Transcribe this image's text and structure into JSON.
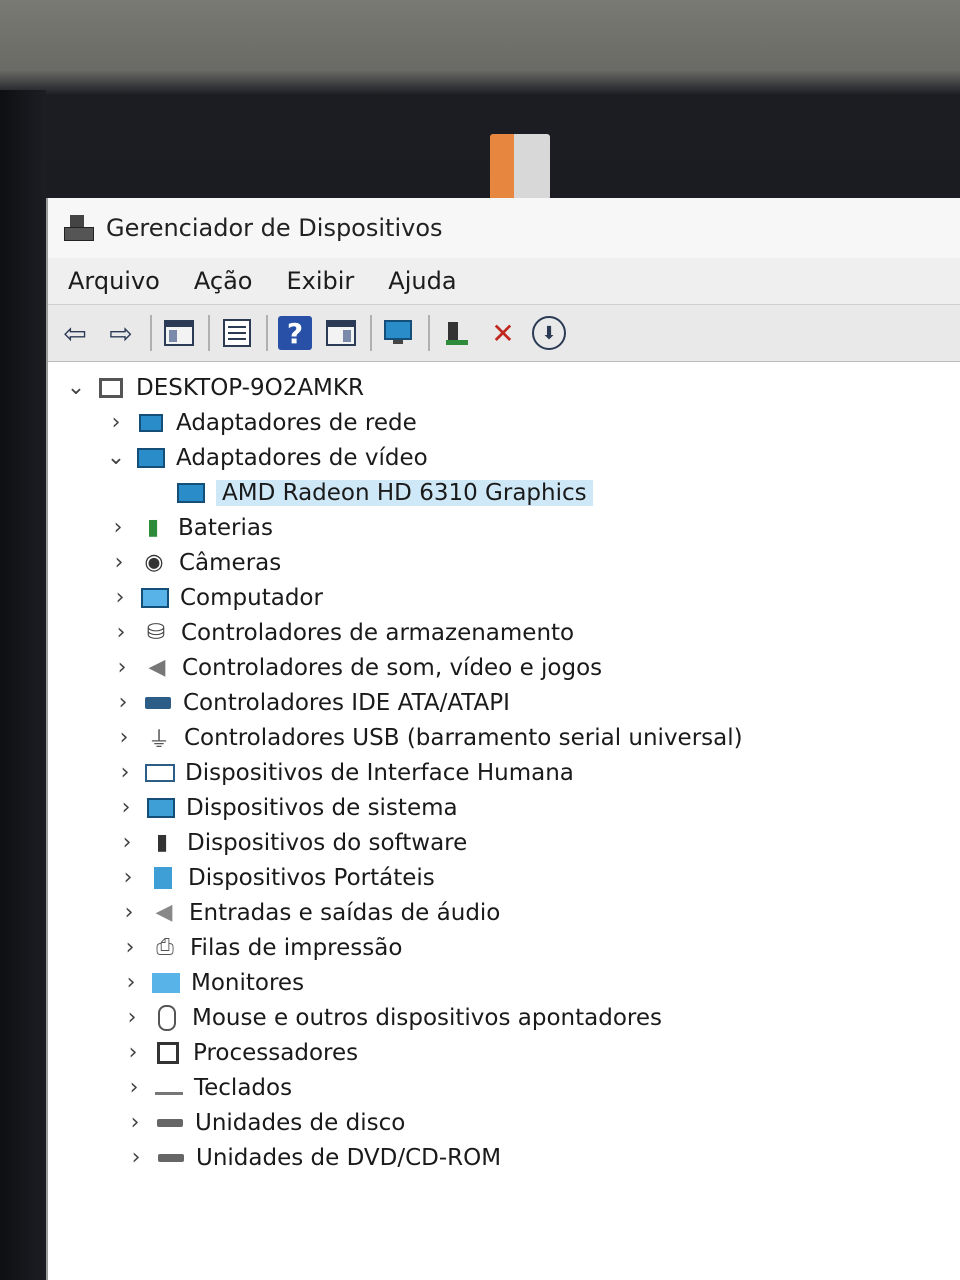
{
  "window": {
    "title": "Gerenciador de Dispositivos"
  },
  "menu": [
    "Arquivo",
    "Ação",
    "Exibir",
    "Ajuda"
  ],
  "toolbar": {
    "back": "⇦",
    "forward": "⇨",
    "help": "?",
    "delete": "✕",
    "update": "⬇"
  },
  "tree": {
    "root": "DESKTOP-9O2AMKR",
    "items": [
      "Adaptadores de rede",
      "Adaptadores de vídeo",
      "AMD Radeon HD 6310 Graphics",
      "Baterias",
      "Câmeras",
      "Computador",
      "Controladores de armazenamento",
      "Controladores de som, vídeo e jogos",
      "Controladores IDE ATA/ATAPI",
      "Controladores USB (barramento serial universal)",
      "Dispositivos de Interface Humana",
      "Dispositivos de sistema",
      "Dispositivos do software",
      "Dispositivos Portáteis",
      "Entradas e saídas de áudio",
      "Filas de impressão",
      "Monitores",
      "Mouse e outros dispositivos apontadores",
      "Processadores",
      "Teclados",
      "Unidades de disco",
      "Unidades de DVD/CD-ROM"
    ]
  },
  "colors": {
    "accent": "#2a8cc9",
    "selection": "#cfe8f7"
  }
}
